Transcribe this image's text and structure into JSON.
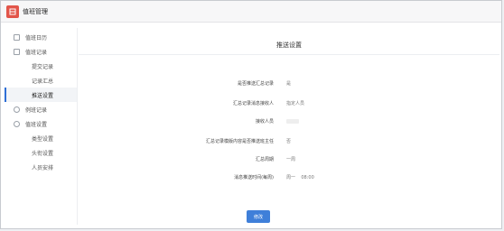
{
  "app": {
    "title": "值班管理"
  },
  "sidebar": {
    "items": [
      {
        "label": "值班日历",
        "icon": "calendar-icon"
      },
      {
        "label": "值班记录",
        "icon": "record-icon"
      },
      {
        "label": "提交记录"
      },
      {
        "label": "记录汇总"
      },
      {
        "label": "推送设置",
        "active": true
      },
      {
        "label": "例班记录",
        "icon": "check-circle-icon"
      },
      {
        "label": "值班设置",
        "icon": "settings-icon"
      },
      {
        "label": "类型设置"
      },
      {
        "label": "头衔设置"
      },
      {
        "label": "人员安排"
      }
    ]
  },
  "content": {
    "title": "推送设置",
    "rows": [
      {
        "label": "是否推送汇总记录",
        "value": "是"
      },
      {
        "label": "汇总记录消息接收人",
        "value": "指定人员"
      },
      {
        "label": "接收人员",
        "value": ""
      },
      {
        "label": "汇总记录模版内容是否推送班主任",
        "value": "否"
      },
      {
        "label": "汇总周期",
        "value": "一周"
      },
      {
        "label": "消息推送时间(每周)",
        "value": "周一    08:00"
      }
    ],
    "submit_label": "修改"
  },
  "colors": {
    "accent": "#3f7fd9",
    "logo": "#e2554a"
  }
}
